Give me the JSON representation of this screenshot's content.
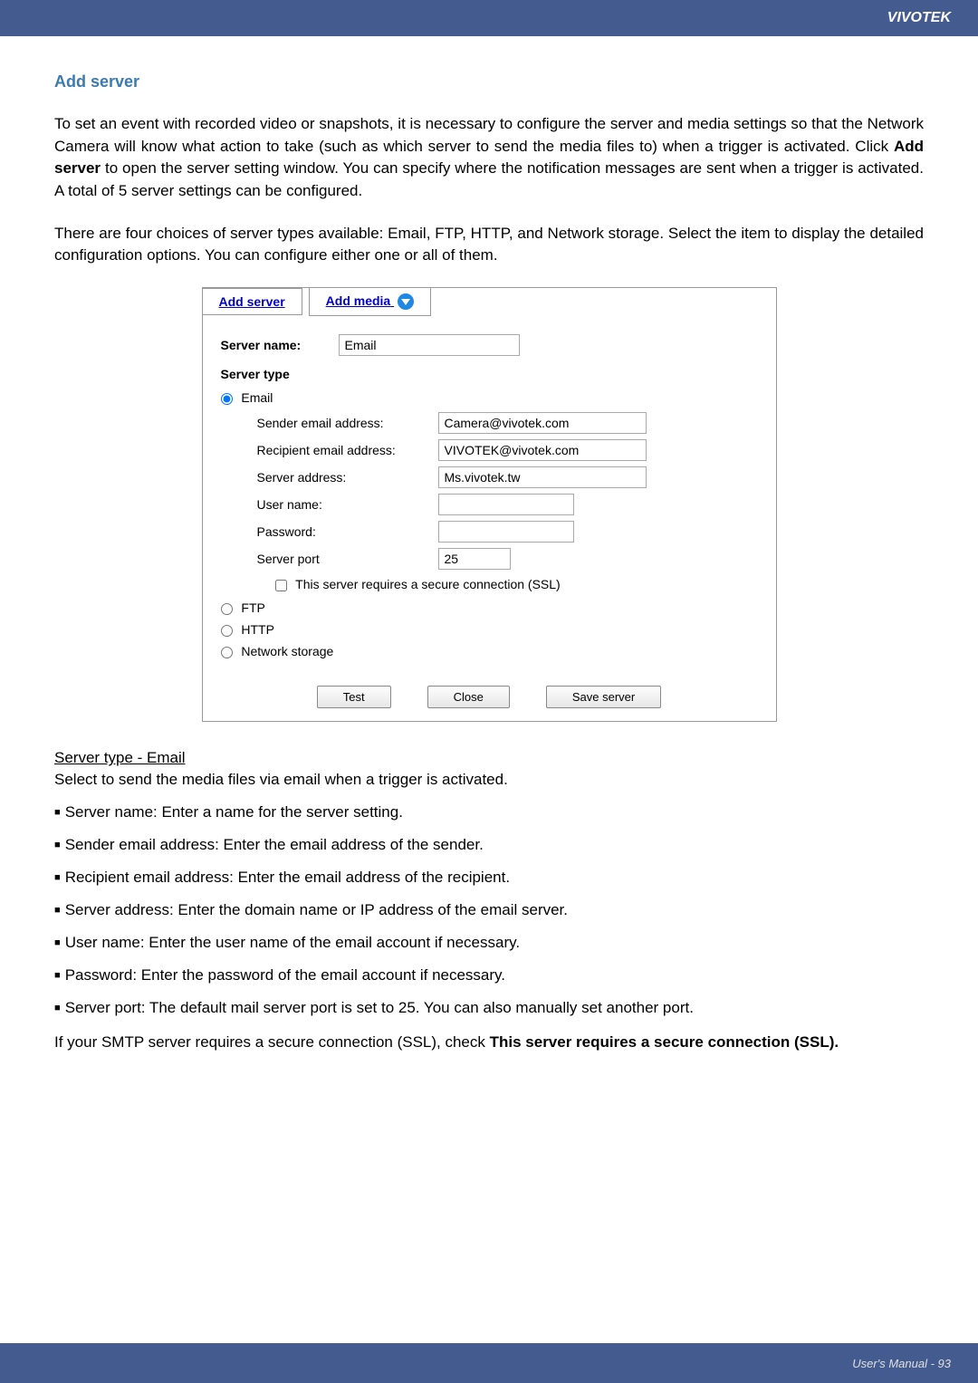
{
  "header": {
    "brand": "VIVOTEK"
  },
  "section": {
    "title": "Add server"
  },
  "intro": {
    "p1_a": "To set an event with recorded video or snapshots, it is necessary to configure the server and media settings so that the Network Camera will know what action to take (such as which server to send the media files to) when a trigger is activated. Click ",
    "p1_bold": "Add server",
    "p1_b": " to open the server setting window. You can specify where the notification messages are sent when a trigger is activated. A total of 5 server settings can be configured.",
    "p2": "There are four choices of server types available: Email, FTP, HTTP, and Network storage. Select the item to display the detailed configuration options. You can configure either one or all of them."
  },
  "tabs": {
    "add_server": "Add server",
    "add_media": "Add media"
  },
  "form": {
    "server_name_label": "Server name:",
    "server_name_value": "Email",
    "server_type_label": "Server type",
    "radio_email": "Email",
    "radio_ftp": "FTP",
    "radio_http": "HTTP",
    "radio_ns": "Network storage",
    "sender_label": "Sender email address:",
    "sender_value": "Camera@vivotek.com",
    "recipient_label": "Recipient email address:",
    "recipient_value": "VIVOTEK@vivotek.com",
    "server_addr_label": "Server address:",
    "server_addr_value": "Ms.vivotek.tw",
    "username_label": "User name:",
    "username_value": "",
    "password_label": "Password:",
    "password_value": "",
    "port_label": "Server port",
    "port_value": "25",
    "ssl_label": "This server requires a secure connection (SSL)",
    "btn_test": "Test",
    "btn_close": "Close",
    "btn_save": "Save server"
  },
  "subsection": {
    "heading": "Server type - Email",
    "desc": "Select to send the media files via email when a trigger is activated.",
    "bullets": [
      "Server name: Enter a name for the server setting.",
      "Sender email address: Enter the email address of the sender.",
      "Recipient email address: Enter the email address of the recipient.",
      "Server address: Enter the domain name or IP address of the email server.",
      "User name: Enter the user name of the email account if necessary.",
      "Password: Enter the password of the email account if necessary.",
      "Server port: The default mail server port is set to 25. You can also manually set another port."
    ],
    "note_a": "If your SMTP server requires a secure connection (SSL), check ",
    "note_bold": "This server requires a secure connection (SSL)."
  },
  "footer": {
    "page": "User's Manual - 93"
  }
}
